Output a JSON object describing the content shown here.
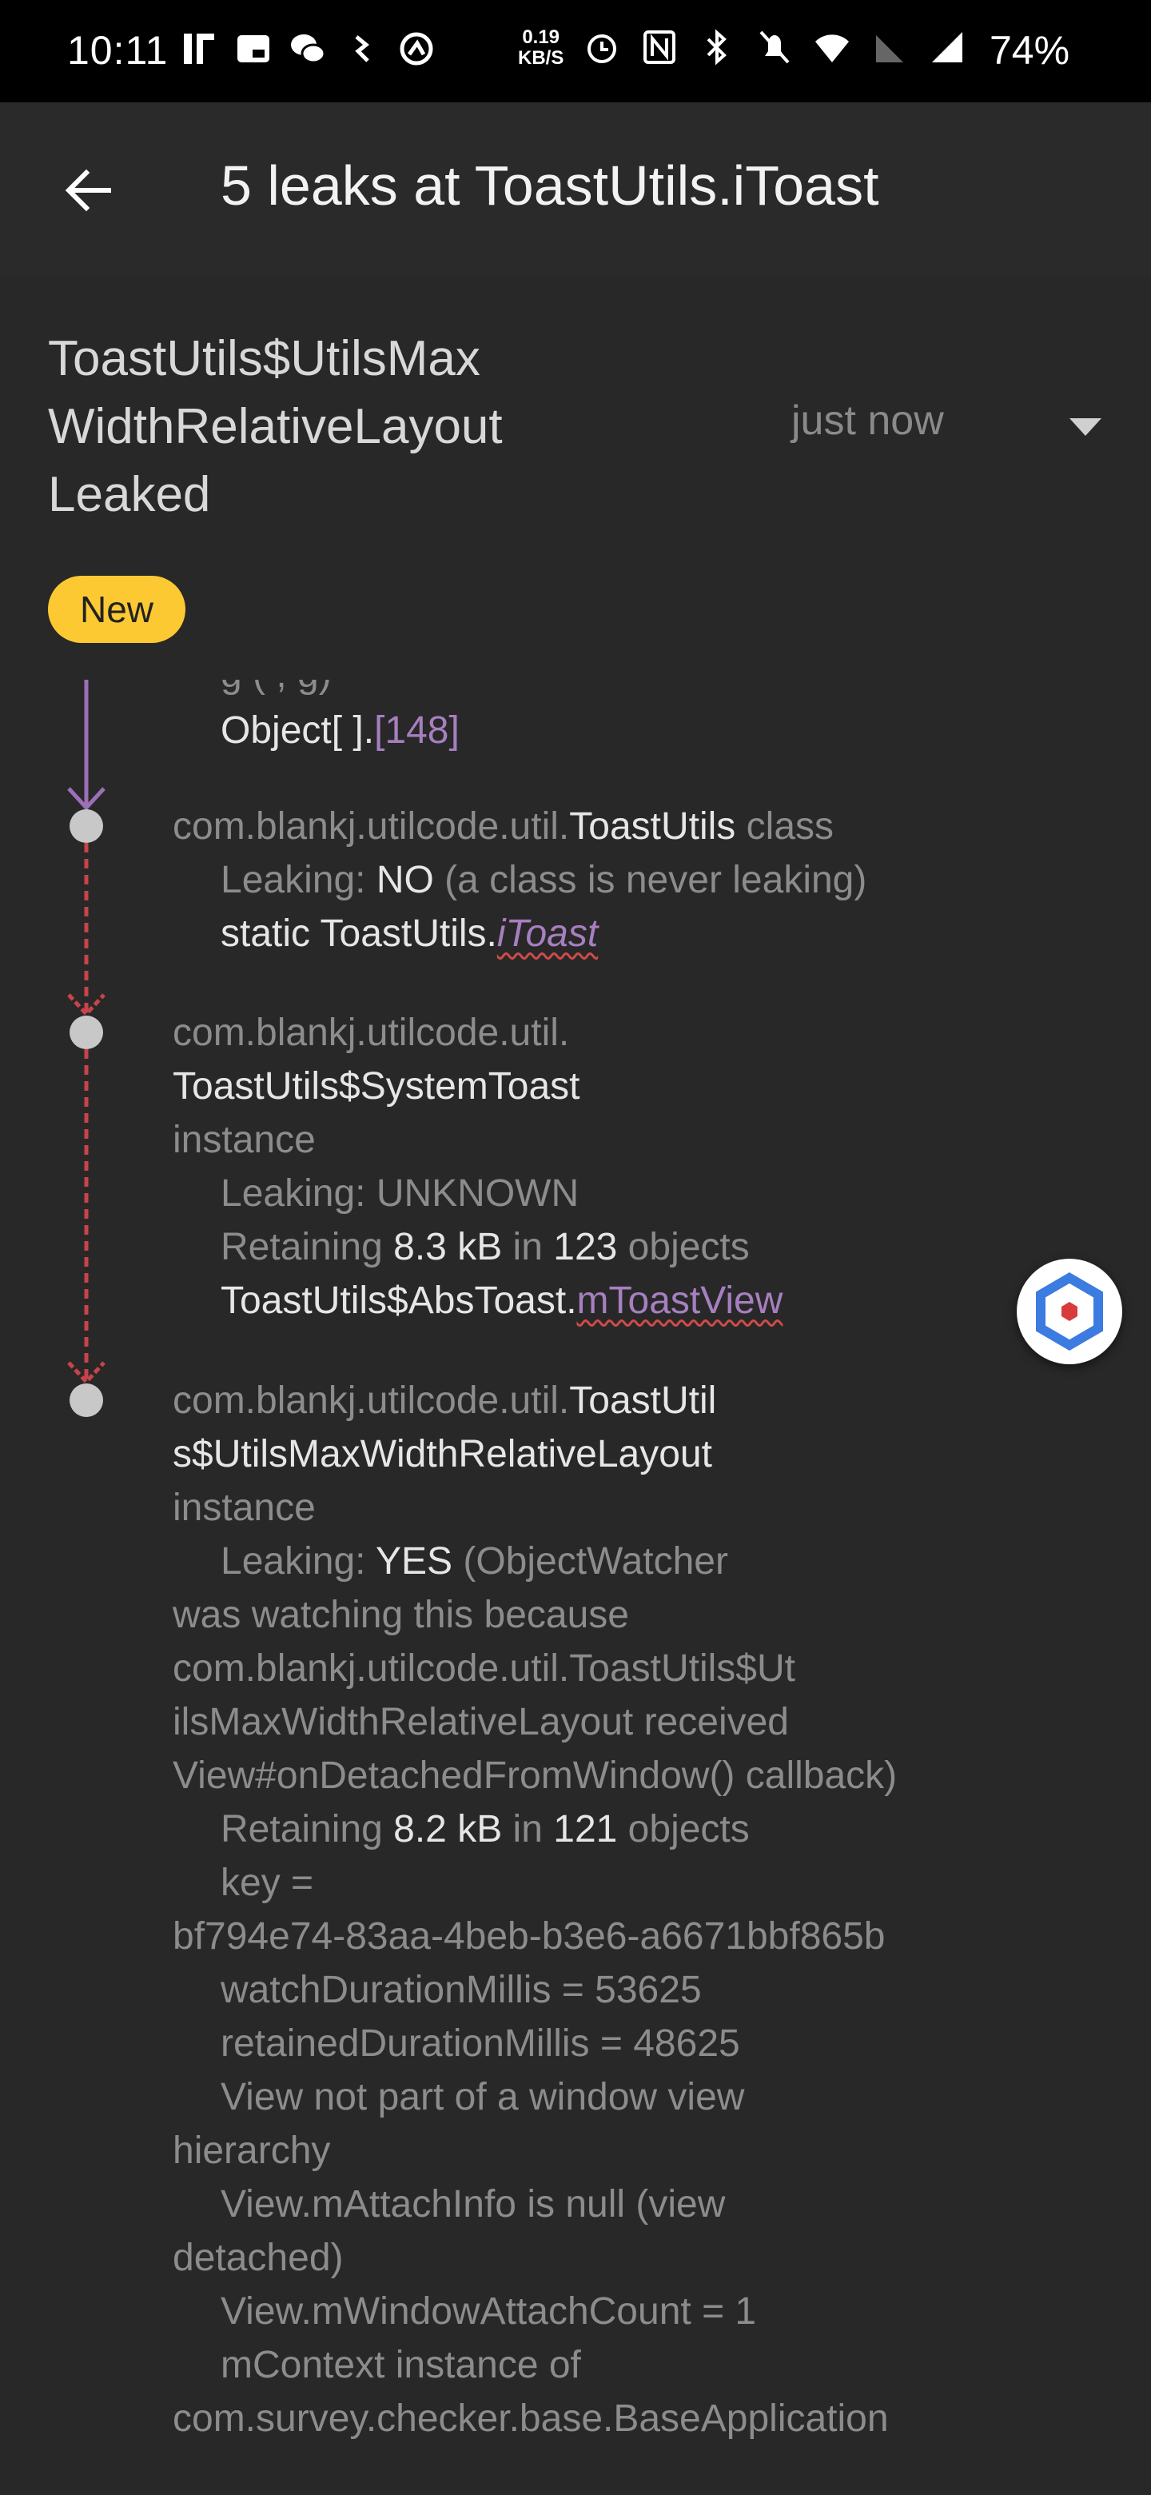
{
  "status_bar": {
    "time": "10:11",
    "net_speed_value": "0.19",
    "net_speed_unit": "KB/S",
    "battery": "74%",
    "left_icons": [
      "listen-icon",
      "sim-icon",
      "wechat-icon",
      "usb-icon",
      "sync-icon"
    ],
    "right_icons": [
      "alarm-icon",
      "nfc-icon",
      "bluetooth-icon",
      "mute-icon",
      "wifi-icon",
      "no-sim-icon",
      "signal-icon"
    ]
  },
  "toolbar": {
    "title": "5 leaks at ToastUtils.iToast"
  },
  "leak": {
    "title": "ToastUtils$UtilsMax WidthRelativeLayout Leaked",
    "time": "just now",
    "badge": "New"
  },
  "trace": {
    "clipped_top_line": "Object[ ].",
    "clipped_top_index": "[148]",
    "clipped_partial": "                 g            (                                  ,                          g)",
    "node1": {
      "pkg": "com.blankj.utilcode.util.",
      "cls": "ToastUtils",
      "suffix": " class",
      "leaking_label": "Leaking: ",
      "leaking_value": "NO",
      "leaking_note": " (a class is never leaking)",
      "ref_prefix": "static ToastUtils.",
      "ref_field": "iToast"
    },
    "node2": {
      "pkg": "com.blankj.utilcode.util.",
      "cls": "ToastUtils$SystemToast",
      "kind": "instance",
      "leaking_label": "Leaking: ",
      "leaking_value": "UNKNOWN",
      "retaining_label": "Retaining ",
      "retaining_size": "8.3 kB",
      "retaining_in": " in ",
      "retaining_count": "123",
      "retaining_suffix": " objects",
      "ref_prefix": "ToastUtils$AbsToast.",
      "ref_field": "mToastView"
    },
    "node3": {
      "pkg": "com.blankj.utilcode.util.",
      "cls_line1": "ToastUtil",
      "cls_line2": "s$UtilsMaxWidthRelativeLayout",
      "kind": "instance",
      "leaking_label": "Leaking: ",
      "leaking_value": "YES",
      "leaking_note_1": " (ObjectWatcher",
      "leaking_note_2": "was watching this because",
      "leaking_note_3": "com.blankj.utilcode.util.ToastUtils$Ut",
      "leaking_note_4": "ilsMaxWidthRelativeLayout received",
      "leaking_note_5": "View#onDetachedFromWindow() callback)",
      "retaining_label": "Retaining ",
      "retaining_size": "8.2 kB",
      "retaining_in": " in ",
      "retaining_count": "121",
      "retaining_suffix": " objects",
      "key_label": "key =",
      "key_value": "bf794e74-83aa-4beb-b3e6-a6671bbf865b",
      "watch": "watchDurationMillis = 53625",
      "retained": "retainedDurationMillis = 48625",
      "not_part_1": "View not part of a window view",
      "not_part_2": "hierarchy",
      "attach_1": "View.mAttachInfo is null (view",
      "attach_2": "detached)",
      "window_attach": "View.mWindowAttachCount = 1",
      "context_1": "mContext instance of",
      "context_2": "com.survey.checker.base.BaseApplication"
    }
  },
  "colors": {
    "background": "#282828",
    "badge": "#fcc933",
    "reference": "#a77fc0",
    "leak_arrow": "#c8434a",
    "safe_arrow": "#9c6fb8"
  },
  "fab_icon": "app-logo-icon"
}
